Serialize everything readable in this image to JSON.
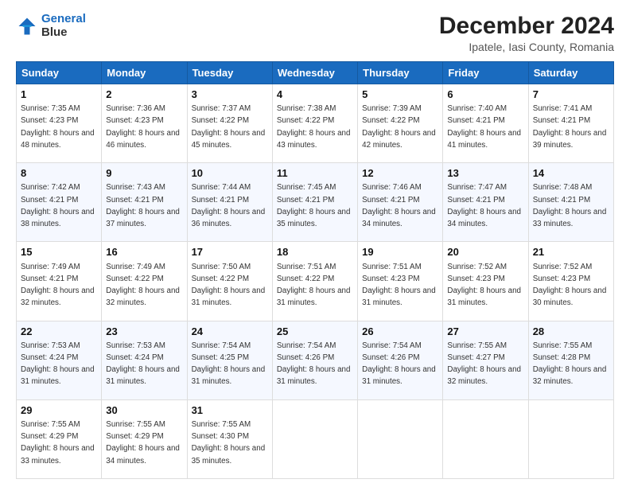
{
  "header": {
    "logo_line1": "General",
    "logo_line2": "Blue",
    "title": "December 2024",
    "subtitle": "Ipatele, Iasi County, Romania"
  },
  "weekdays": [
    "Sunday",
    "Monday",
    "Tuesday",
    "Wednesday",
    "Thursday",
    "Friday",
    "Saturday"
  ],
  "weeks": [
    [
      {
        "day": "1",
        "sunrise": "7:35 AM",
        "sunset": "4:23 PM",
        "daylight": "8 hours and 48 minutes."
      },
      {
        "day": "2",
        "sunrise": "7:36 AM",
        "sunset": "4:23 PM",
        "daylight": "8 hours and 46 minutes."
      },
      {
        "day": "3",
        "sunrise": "7:37 AM",
        "sunset": "4:22 PM",
        "daylight": "8 hours and 45 minutes."
      },
      {
        "day": "4",
        "sunrise": "7:38 AM",
        "sunset": "4:22 PM",
        "daylight": "8 hours and 43 minutes."
      },
      {
        "day": "5",
        "sunrise": "7:39 AM",
        "sunset": "4:22 PM",
        "daylight": "8 hours and 42 minutes."
      },
      {
        "day": "6",
        "sunrise": "7:40 AM",
        "sunset": "4:21 PM",
        "daylight": "8 hours and 41 minutes."
      },
      {
        "day": "7",
        "sunrise": "7:41 AM",
        "sunset": "4:21 PM",
        "daylight": "8 hours and 39 minutes."
      }
    ],
    [
      {
        "day": "8",
        "sunrise": "7:42 AM",
        "sunset": "4:21 PM",
        "daylight": "8 hours and 38 minutes."
      },
      {
        "day": "9",
        "sunrise": "7:43 AM",
        "sunset": "4:21 PM",
        "daylight": "8 hours and 37 minutes."
      },
      {
        "day": "10",
        "sunrise": "7:44 AM",
        "sunset": "4:21 PM",
        "daylight": "8 hours and 36 minutes."
      },
      {
        "day": "11",
        "sunrise": "7:45 AM",
        "sunset": "4:21 PM",
        "daylight": "8 hours and 35 minutes."
      },
      {
        "day": "12",
        "sunrise": "7:46 AM",
        "sunset": "4:21 PM",
        "daylight": "8 hours and 34 minutes."
      },
      {
        "day": "13",
        "sunrise": "7:47 AM",
        "sunset": "4:21 PM",
        "daylight": "8 hours and 34 minutes."
      },
      {
        "day": "14",
        "sunrise": "7:48 AM",
        "sunset": "4:21 PM",
        "daylight": "8 hours and 33 minutes."
      }
    ],
    [
      {
        "day": "15",
        "sunrise": "7:49 AM",
        "sunset": "4:21 PM",
        "daylight": "8 hours and 32 minutes."
      },
      {
        "day": "16",
        "sunrise": "7:49 AM",
        "sunset": "4:22 PM",
        "daylight": "8 hours and 32 minutes."
      },
      {
        "day": "17",
        "sunrise": "7:50 AM",
        "sunset": "4:22 PM",
        "daylight": "8 hours and 31 minutes."
      },
      {
        "day": "18",
        "sunrise": "7:51 AM",
        "sunset": "4:22 PM",
        "daylight": "8 hours and 31 minutes."
      },
      {
        "day": "19",
        "sunrise": "7:51 AM",
        "sunset": "4:23 PM",
        "daylight": "8 hours and 31 minutes."
      },
      {
        "day": "20",
        "sunrise": "7:52 AM",
        "sunset": "4:23 PM",
        "daylight": "8 hours and 31 minutes."
      },
      {
        "day": "21",
        "sunrise": "7:52 AM",
        "sunset": "4:23 PM",
        "daylight": "8 hours and 30 minutes."
      }
    ],
    [
      {
        "day": "22",
        "sunrise": "7:53 AM",
        "sunset": "4:24 PM",
        "daylight": "8 hours and 31 minutes."
      },
      {
        "day": "23",
        "sunrise": "7:53 AM",
        "sunset": "4:24 PM",
        "daylight": "8 hours and 31 minutes."
      },
      {
        "day": "24",
        "sunrise": "7:54 AM",
        "sunset": "4:25 PM",
        "daylight": "8 hours and 31 minutes."
      },
      {
        "day": "25",
        "sunrise": "7:54 AM",
        "sunset": "4:26 PM",
        "daylight": "8 hours and 31 minutes."
      },
      {
        "day": "26",
        "sunrise": "7:54 AM",
        "sunset": "4:26 PM",
        "daylight": "8 hours and 31 minutes."
      },
      {
        "day": "27",
        "sunrise": "7:55 AM",
        "sunset": "4:27 PM",
        "daylight": "8 hours and 32 minutes."
      },
      {
        "day": "28",
        "sunrise": "7:55 AM",
        "sunset": "4:28 PM",
        "daylight": "8 hours and 32 minutes."
      }
    ],
    [
      {
        "day": "29",
        "sunrise": "7:55 AM",
        "sunset": "4:29 PM",
        "daylight": "8 hours and 33 minutes."
      },
      {
        "day": "30",
        "sunrise": "7:55 AM",
        "sunset": "4:29 PM",
        "daylight": "8 hours and 34 minutes."
      },
      {
        "day": "31",
        "sunrise": "7:55 AM",
        "sunset": "4:30 PM",
        "daylight": "8 hours and 35 minutes."
      },
      null,
      null,
      null,
      null
    ]
  ]
}
